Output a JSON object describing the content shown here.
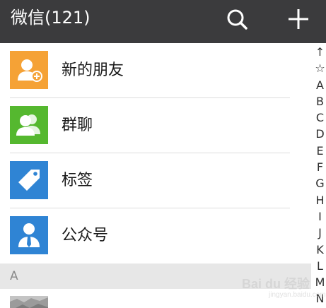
{
  "header": {
    "title": "微信(121)",
    "search_icon": "search-icon",
    "add_icon": "plus-icon"
  },
  "rows": [
    {
      "label": "新的朋友",
      "icon": "add-friend-icon",
      "color": "#f5a236"
    },
    {
      "label": "群聊",
      "icon": "group-chat-icon",
      "color": "#55b82f"
    },
    {
      "label": "标签",
      "icon": "tag-icon",
      "color": "#2f84d4"
    },
    {
      "label": "公众号",
      "icon": "official-account-icon",
      "color": "#2f84d4"
    }
  ],
  "section": {
    "letter": "A"
  },
  "index_bar": [
    "↑",
    "☆",
    "A",
    "B",
    "C",
    "D",
    "E",
    "F",
    "G",
    "H",
    "I",
    "J",
    "K",
    "L",
    "M",
    "N"
  ],
  "watermark": {
    "text": "Bai du 经验",
    "sub": "jingyan.baidu.com"
  }
}
